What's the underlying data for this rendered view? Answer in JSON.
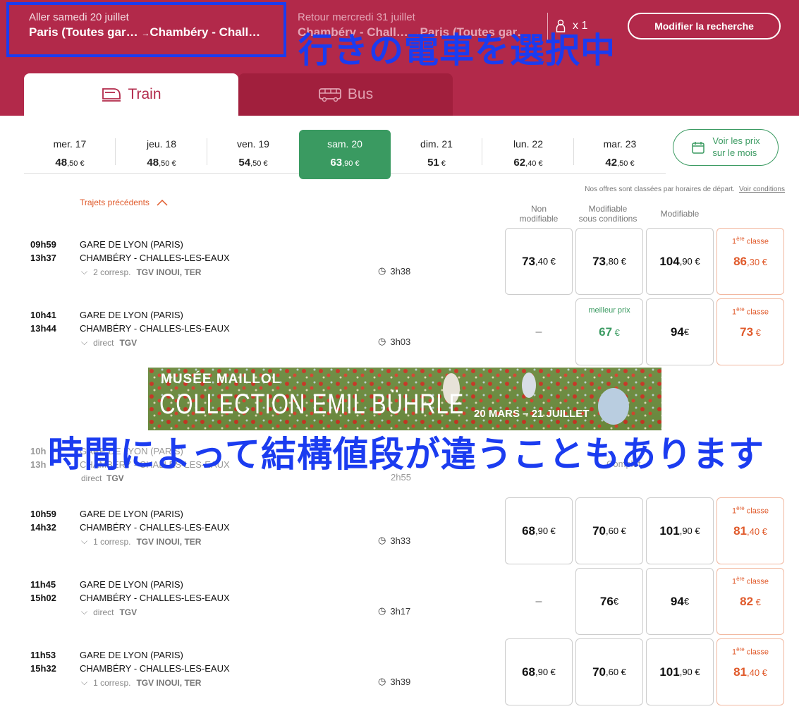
{
  "header": {
    "outbound": {
      "label": "Aller samedi 20 juillet",
      "from": "Paris (Toutes gar…",
      "to": "Chambéry - Chall…"
    },
    "return": {
      "label": "Retour mercredi 31 juillet",
      "from": "Chambéry - Chall…",
      "to": "Paris (Toutes gar…"
    },
    "passengers": "x 1",
    "modify_label": "Modifier la recherche",
    "annotation": "行きの電車を選択中"
  },
  "tabs": {
    "train": "Train",
    "bus": "Bus"
  },
  "dates": [
    {
      "day": "mer. 17",
      "int": "48",
      "dec": ",50 €"
    },
    {
      "day": "jeu. 18",
      "int": "48",
      "dec": ",50 €"
    },
    {
      "day": "ven. 19",
      "int": "54",
      "dec": ",50 €"
    },
    {
      "day": "sam. 20",
      "int": "63",
      "dec": ",90 €",
      "selected": true
    },
    {
      "day": "dim. 21",
      "int": "51",
      "dec": " €"
    },
    {
      "day": "lun. 22",
      "int": "62",
      "dec": ",40 €"
    },
    {
      "day": "mar. 23",
      "int": "42",
      "dec": ",50 €"
    }
  ],
  "month_button": {
    "line1": "Voir les prix",
    "line2": "sur le mois"
  },
  "sort_note": "Nos offres sont classées par horaires de départ.",
  "conditions_link": "Voir conditions",
  "previous": "Trajets précédents",
  "columns": {
    "c1a": "Non",
    "c1b": "modifiable",
    "c2a": "Modifiable",
    "c2b": "sous conditions",
    "c3": "Modifiable"
  },
  "first_class_label": "classe",
  "first_class_sup": "ère",
  "best_price_label": "meilleur prix",
  "dash": "–",
  "trips": [
    {
      "dep": "09h59",
      "arr": "13h37",
      "from": "GARE DE LYON (PARIS)",
      "to": "CHAMBÉRY - CHALLES-LES-EAUX",
      "corr": "2 corresp.",
      "trains": "TGV INOUI, TER",
      "duration": "3h38",
      "p1": {
        "i": "73",
        "d": ",40 €"
      },
      "p2": {
        "i": "73",
        "d": ",80 €"
      },
      "p3": {
        "i": "104",
        "d": ",90 €"
      },
      "p4": {
        "i": "86",
        "d": ",30 €"
      }
    },
    {
      "dep": "10h41",
      "arr": "13h44",
      "from": "GARE DE LYON (PARIS)",
      "to": "CHAMBÉRY - CHALLES-LES-EAUX",
      "corr": "direct",
      "trains": "TGV",
      "duration": "3h03",
      "p1": null,
      "p2": {
        "i": "67",
        "d": " €",
        "best": true
      },
      "p3": {
        "i": "94",
        "d": " €"
      },
      "p4": {
        "i": "73",
        "d": " €"
      }
    },
    {
      "dep": "10h59",
      "arr": "14h32",
      "from": "GARE DE LYON (PARIS)",
      "to": "CHAMBÉRY - CHALLES-LES-EAUX",
      "corr": "1 corresp.",
      "trains": "TGV INOUI, TER",
      "duration": "3h33",
      "p1": {
        "i": "68",
        "d": ",90 €"
      },
      "p2": {
        "i": "70",
        "d": ",60 €"
      },
      "p3": {
        "i": "101",
        "d": ",90 €"
      },
      "p4": {
        "i": "81",
        "d": ",40 €"
      }
    },
    {
      "dep": "11h45",
      "arr": "15h02",
      "from": "GARE DE LYON (PARIS)",
      "to": "CHAMBÉRY - CHALLES-LES-EAUX",
      "corr": "direct",
      "trains": "TGV",
      "duration": "3h17",
      "p1": null,
      "p2": {
        "i": "76",
        "d": " €"
      },
      "p3": {
        "i": "94",
        "d": " €"
      },
      "p4": {
        "i": "82",
        "d": " €"
      }
    },
    {
      "dep": "11h53",
      "arr": "15h32",
      "from": "GARE DE LYON (PARIS)",
      "to": "CHAMBÉRY - CHALLES-LES-EAUX",
      "corr": "1 corresp.",
      "trains": "TGV INOUI, TER",
      "duration": "3h39",
      "p1": {
        "i": "68",
        "d": ",90 €"
      },
      "p2": {
        "i": "70",
        "d": ",60 €"
      },
      "p3": {
        "i": "101",
        "d": ",90 €"
      },
      "p4": {
        "i": "81",
        "d": ",40 €"
      }
    }
  ],
  "hidden_row": {
    "dep": "10h",
    "arr": "13h",
    "from": "GARE DE LYON (PARIS)",
    "to": "CHAMBÉRY - CHALLES-LES-EAUX",
    "corr": "direct",
    "trains": "TGV",
    "duration": "2h55",
    "status": "Complet"
  },
  "ad": {
    "title": "MUSÉE MAILLOL",
    "subtitle": "COLLECTION EMIL BÜHRLE",
    "dates": "20 MARS – 21 JUILLET"
  },
  "annotation2": "時間によって結構値段が違うこともあります"
}
